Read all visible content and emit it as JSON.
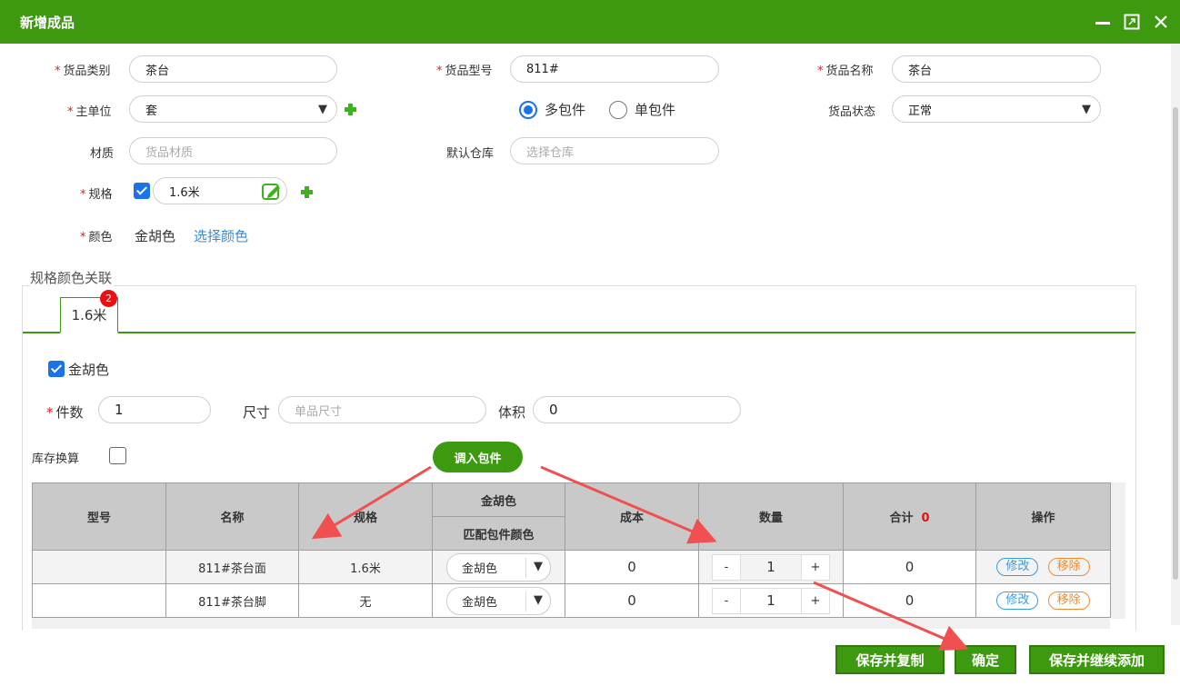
{
  "window": {
    "title": "新增成品"
  },
  "form": {
    "category": {
      "label": "货品类别",
      "value": "茶台"
    },
    "model": {
      "label": "货品型号",
      "value": "811#"
    },
    "name": {
      "label": "货品名称",
      "value": "茶台"
    },
    "unit": {
      "label": "主单位",
      "value": "套"
    },
    "package_type": {
      "options": [
        "多包件",
        "单包件"
      ],
      "selected": "多包件"
    },
    "status": {
      "label": "货品状态",
      "value": "正常"
    },
    "material": {
      "label": "材质",
      "placeholder": "货品材质"
    },
    "warehouse": {
      "label": "默认仓库",
      "placeholder": "选择仓库"
    },
    "spec": {
      "label": "规格",
      "value": "1.6米",
      "checked": true
    },
    "color": {
      "label": "颜色",
      "value": "金胡色",
      "link": "选择颜色"
    }
  },
  "relation": {
    "legend": "规格颜色关联",
    "tabs": [
      {
        "label": "1.6米",
        "badge": "2"
      }
    ],
    "color_checkbox": {
      "label": "金胡色",
      "checked": true
    },
    "pieces": {
      "label": "件数",
      "value": "1"
    },
    "size": {
      "label": "尺寸",
      "placeholder": "单品尺寸"
    },
    "volume": {
      "label": "体积",
      "value": "0"
    },
    "stock_convert": {
      "label": "库存换算",
      "checked": false
    },
    "import_button": "调入包件"
  },
  "table": {
    "headers": {
      "model": "型号",
      "name": "名称",
      "spec": "规格",
      "color_group": "金胡色",
      "match_color": "匹配包件颜色",
      "cost": "成本",
      "qty": "数量",
      "total": "合计",
      "total_value": "0",
      "actions": "操作"
    },
    "rows": [
      {
        "model": "",
        "name": "811#茶台面",
        "spec": "1.6米",
        "color": "金胡色",
        "cost": "0",
        "qty": "1",
        "total": "0",
        "edit": "修改",
        "remove": "移除"
      },
      {
        "model": "",
        "name": "811#茶台脚",
        "spec": "无",
        "color": "金胡色",
        "cost": "0",
        "qty": "1",
        "total": "0",
        "edit": "修改",
        "remove": "移除"
      }
    ],
    "minus": "-",
    "plus": "+"
  },
  "footer": {
    "save_copy": "保存并复制",
    "confirm": "确定",
    "save_continue": "保存并继续添加"
  },
  "colors": {
    "accent": "#3d9a10",
    "required": "#e02020",
    "link": "#3a8ad6",
    "annotation_arrow": "#f05050"
  }
}
